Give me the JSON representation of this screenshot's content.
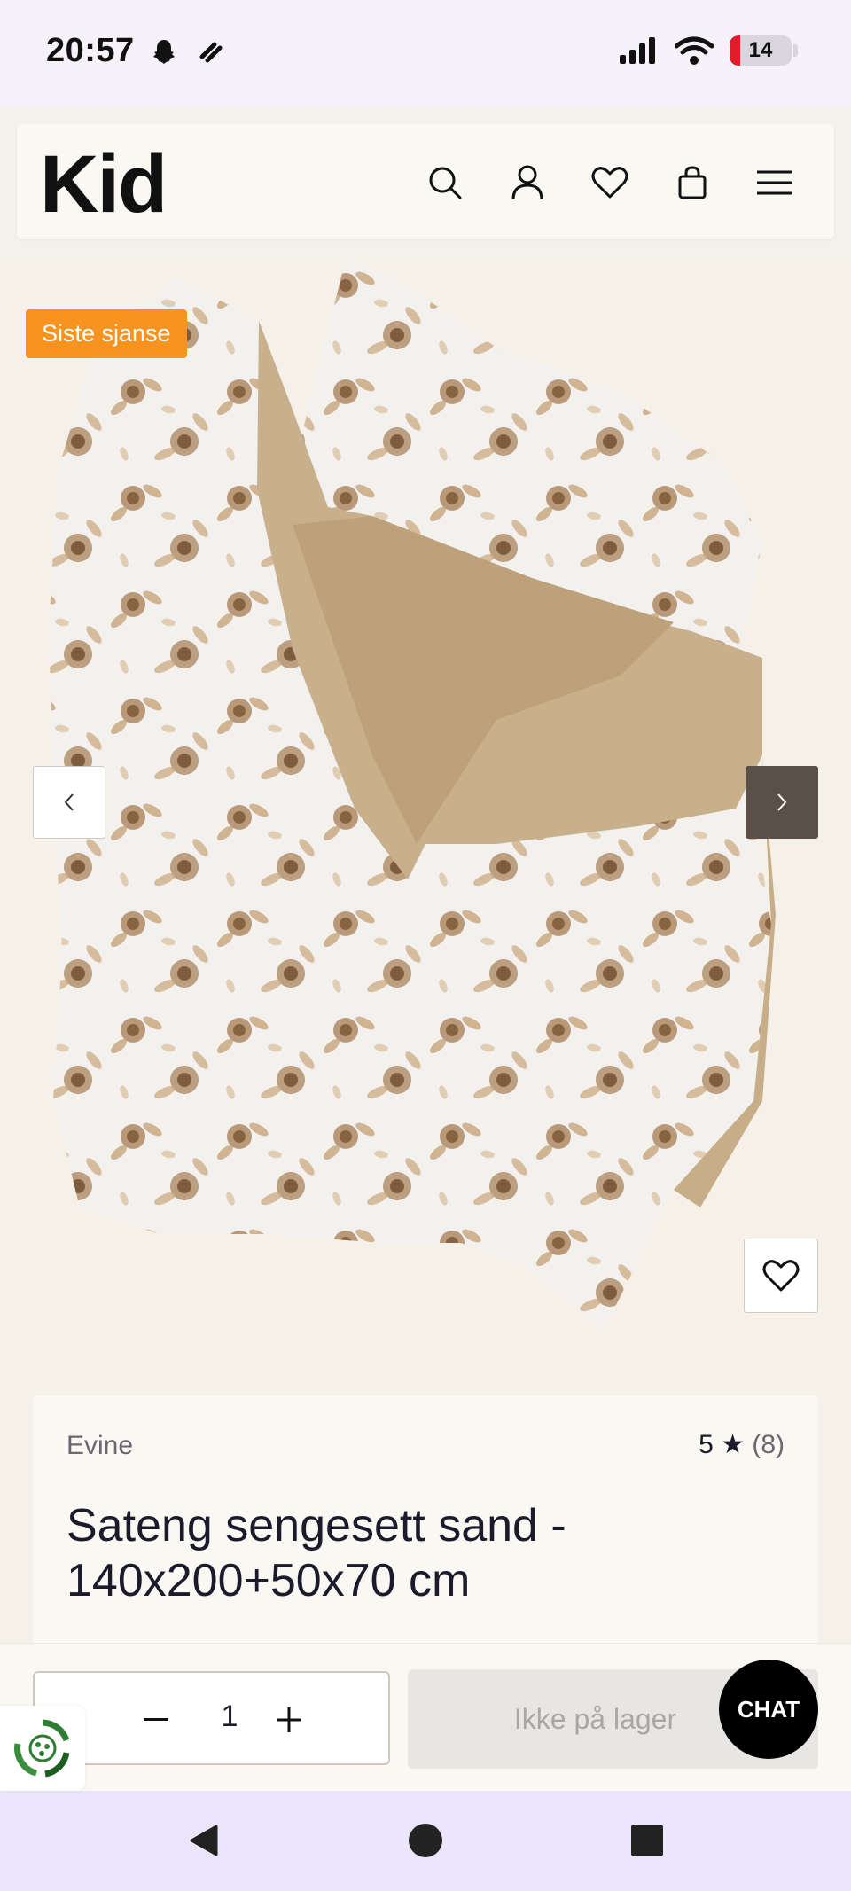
{
  "status_bar": {
    "time": "20:57",
    "battery": "14",
    "icons": [
      "snapchat-icon",
      "tinder-icon",
      "signal-icon",
      "wifi-icon",
      "battery-icon"
    ]
  },
  "header": {
    "logo": "Kid",
    "icons": [
      "search-icon",
      "account-icon",
      "heart-icon",
      "bag-icon",
      "menu-icon"
    ]
  },
  "gallery": {
    "badge": "Siste sjanse",
    "prev_icon": "chevron-left-icon",
    "next_icon": "chevron-right-icon",
    "favorite_icon": "heart-icon"
  },
  "product": {
    "brand": "Evine",
    "rating": "5 ★",
    "rating_count": "(8)",
    "title": "Sateng sengesett sand - 140x200+50x70 cm"
  },
  "purchase": {
    "quantity": "1",
    "stock_button": "Ikke på lager",
    "chat": "CHAT"
  },
  "colors": {
    "accent_badge": "#f7931e",
    "background": "#f5f1e8",
    "next_button": "#5a5048",
    "android_nav": "#ebe6fb"
  }
}
